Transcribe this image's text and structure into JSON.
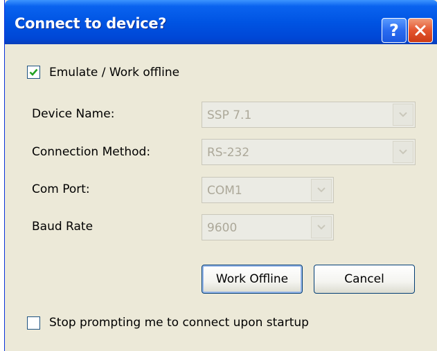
{
  "window": {
    "title": "Connect to device?",
    "help_button_label": "?",
    "close_button_label": "✕"
  },
  "emulate": {
    "label": "Emulate / Work offline",
    "checked": true
  },
  "fields": {
    "device_name": {
      "label": "Device Name:",
      "value": "SSP 7.1",
      "enabled": false
    },
    "connection_method": {
      "label": "Connection Method:",
      "value": "RS-232",
      "enabled": false
    },
    "com_port": {
      "label": "Com Port:",
      "value": "COM1",
      "enabled": false
    },
    "baud_rate": {
      "label": "Baud Rate",
      "value": "9600",
      "enabled": false
    }
  },
  "buttons": {
    "work_offline": "Work Offline",
    "cancel": "Cancel"
  },
  "stop_prompting": {
    "label": "Stop prompting me to connect upon startup",
    "checked": false
  },
  "colors": {
    "titlebar": "#0054e3",
    "dialog_bg": "#ece9d8",
    "check_mark": "#21a121",
    "disabled_text": "#aca899"
  }
}
